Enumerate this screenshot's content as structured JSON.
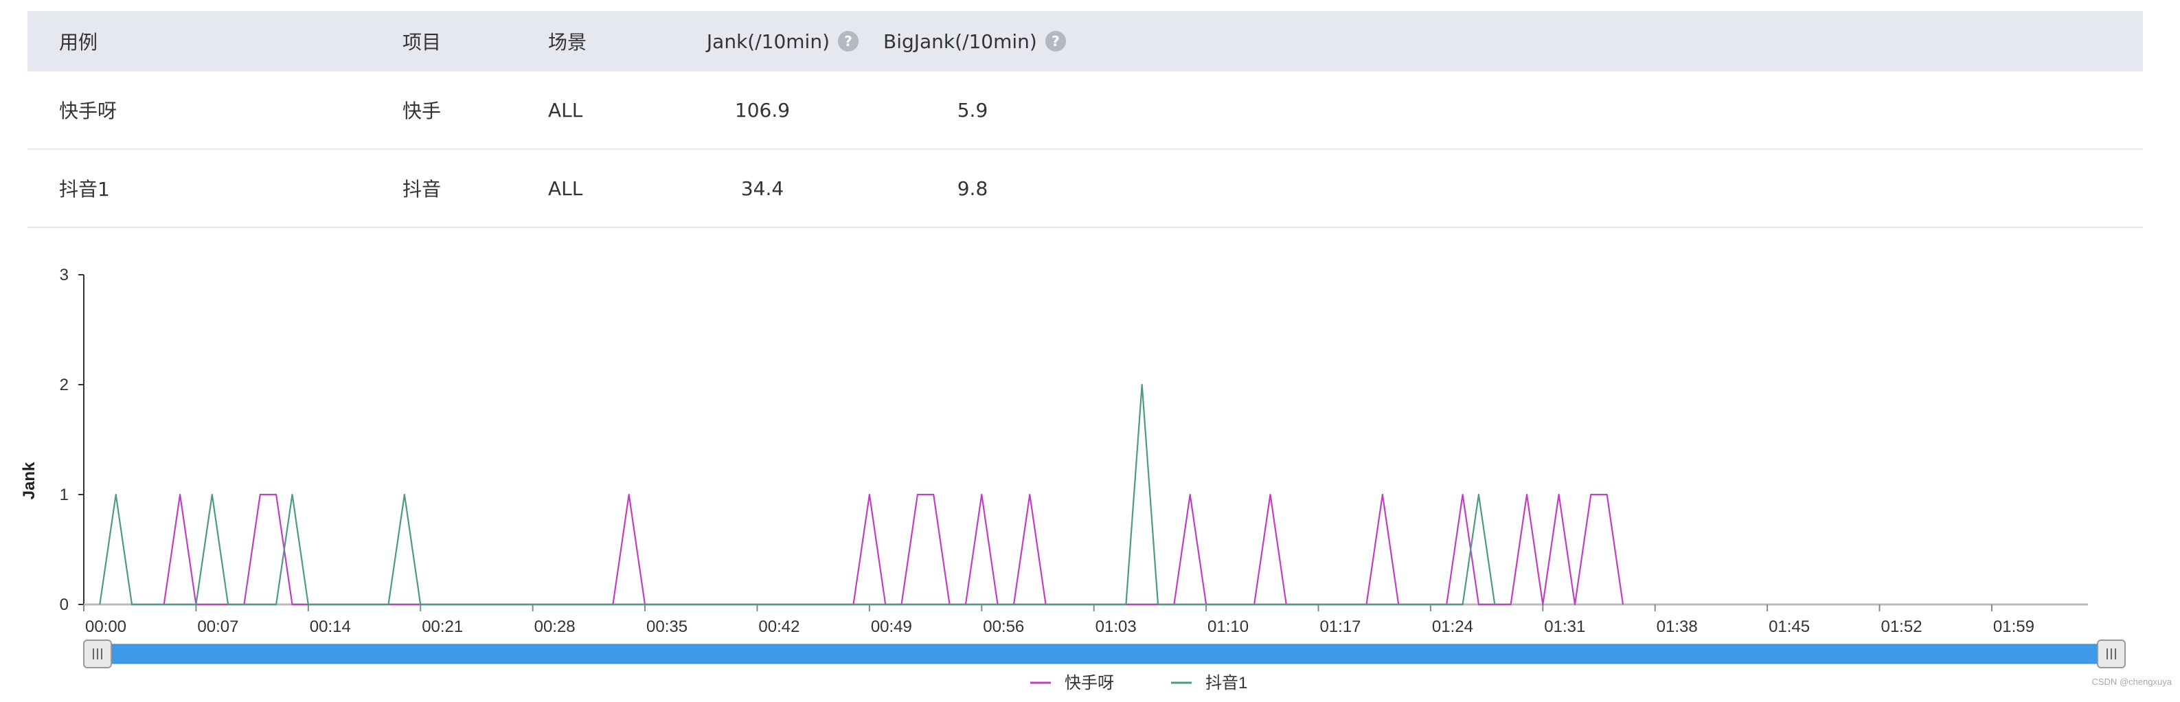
{
  "table": {
    "headers": {
      "case": "用例",
      "project": "项目",
      "scene": "场景",
      "jank": "Jank(/10min)",
      "bigjank": "BigJank(/10min)"
    },
    "help_glyph": "?",
    "rows": [
      {
        "case": "快手呀",
        "project": "快手",
        "scene": "ALL",
        "jank": "106.9",
        "bigjank": "5.9"
      },
      {
        "case": "抖音1",
        "project": "抖音",
        "scene": "ALL",
        "jank": "34.4",
        "bigjank": "9.8"
      }
    ]
  },
  "chart_data": {
    "type": "line",
    "ylabel": "Jank",
    "xlabel": "",
    "ylim": [
      0,
      3
    ],
    "yticks": [
      0,
      1,
      2,
      3
    ],
    "x_unit": "minutes",
    "xlim": [
      0,
      125
    ],
    "xticks": [
      "00:00",
      "00:07",
      "00:14",
      "00:21",
      "00:28",
      "00:35",
      "00:42",
      "00:49",
      "00:56",
      "01:03",
      "01:10",
      "01:17",
      "01:24",
      "01:31",
      "01:38",
      "01:45",
      "01:52",
      "01:59"
    ],
    "legend_position": "bottom-center",
    "series": [
      {
        "name": "快手呀",
        "color": "#c13ec3",
        "points": [
          [
            5,
            0
          ],
          [
            6,
            1
          ],
          [
            7,
            0
          ],
          [
            10,
            0
          ],
          [
            11,
            1
          ],
          [
            12,
            1
          ],
          [
            13,
            0
          ],
          [
            33,
            0
          ],
          [
            34,
            1
          ],
          [
            35,
            0
          ],
          [
            48,
            0
          ],
          [
            49,
            1
          ],
          [
            50,
            0
          ],
          [
            51,
            0
          ],
          [
            52,
            1
          ],
          [
            53,
            1
          ],
          [
            54,
            0
          ],
          [
            55,
            0
          ],
          [
            56,
            1
          ],
          [
            57,
            0
          ],
          [
            58,
            0
          ],
          [
            59,
            1
          ],
          [
            60,
            0
          ],
          [
            68,
            0
          ],
          [
            69,
            1
          ],
          [
            70,
            0
          ],
          [
            73,
            0
          ],
          [
            74,
            1
          ],
          [
            75,
            0
          ],
          [
            80,
            0
          ],
          [
            81,
            1
          ],
          [
            82,
            0
          ],
          [
            85,
            0
          ],
          [
            86,
            1
          ],
          [
            87,
            0
          ],
          [
            89,
            0
          ],
          [
            90,
            1
          ],
          [
            91,
            0
          ],
          [
            91,
            0
          ],
          [
            92,
            1
          ],
          [
            93,
            0
          ],
          [
            94,
            1
          ],
          [
            95,
            1
          ],
          [
            96,
            0
          ]
        ]
      },
      {
        "name": "抖音1",
        "color": "#4e9a82",
        "points": [
          [
            1,
            0
          ],
          [
            2,
            1
          ],
          [
            3,
            0
          ],
          [
            7,
            0
          ],
          [
            8,
            1
          ],
          [
            9,
            0
          ],
          [
            12,
            0
          ],
          [
            13,
            1
          ],
          [
            14,
            0
          ],
          [
            19,
            0
          ],
          [
            20,
            1
          ],
          [
            21,
            0
          ],
          [
            65,
            0
          ],
          [
            66,
            2
          ],
          [
            67,
            0
          ],
          [
            86,
            0
          ],
          [
            87,
            1
          ],
          [
            88,
            0
          ]
        ]
      }
    ]
  },
  "watermark": "CSDN @chengxuya"
}
